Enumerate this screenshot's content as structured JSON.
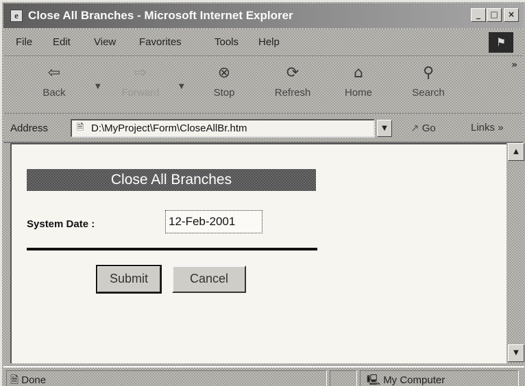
{
  "window": {
    "title": "Close All Branches - Microsoft Internet Explorer",
    "controls": {
      "minimize": "_",
      "maximize": "□",
      "close": "×"
    }
  },
  "menu": {
    "items": [
      "File",
      "Edit",
      "View",
      "Favorites",
      "Tools",
      "Help"
    ]
  },
  "toolbar": {
    "buttons": [
      {
        "label": "Back",
        "icon": "back-arrow-icon",
        "glyph": "⇦",
        "enabled": true
      },
      {
        "label": "Forward",
        "icon": "forward-arrow-icon",
        "glyph": "⇨",
        "enabled": false
      },
      {
        "label": "Stop",
        "icon": "stop-icon",
        "glyph": "⊗",
        "enabled": true
      },
      {
        "label": "Refresh",
        "icon": "refresh-icon",
        "glyph": "⟳",
        "enabled": true
      },
      {
        "label": "Home",
        "icon": "home-icon",
        "glyph": "⌂",
        "enabled": true
      },
      {
        "label": "Search",
        "icon": "search-icon",
        "glyph": "⚲",
        "enabled": true
      }
    ],
    "overflow": "»"
  },
  "address": {
    "label": "Address",
    "url": "D:\\MyProject\\Form\\CloseAllBr.htm",
    "go_label": "Go",
    "links_label": "Links",
    "links_overflow": "»"
  },
  "page": {
    "heading": "Close All Branches",
    "system_date_label": "System Date :",
    "system_date_value": "12-Feb-2001",
    "submit_label": "Submit",
    "cancel_label": "Cancel"
  },
  "status": {
    "text": "Done",
    "zone": "My Computer"
  },
  "colors": {
    "heading_bg": "#6a6a6a",
    "content_bg": "#f7f5f0"
  }
}
